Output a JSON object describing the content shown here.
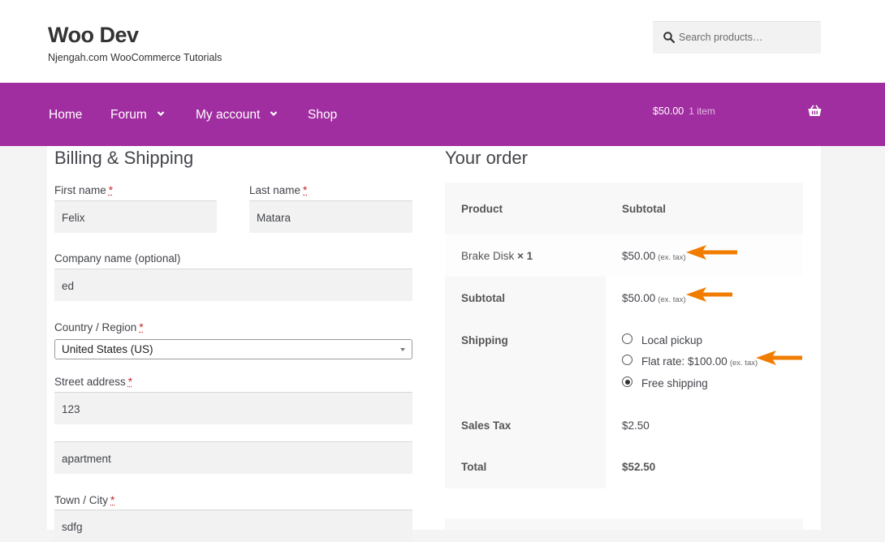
{
  "site": {
    "title": "Woo Dev",
    "description": "Njengah.com WooCommerce Tutorials"
  },
  "search": {
    "placeholder": "Search products…",
    "icon": "search-icon"
  },
  "nav": {
    "items": [
      {
        "label": "Home",
        "has_dropdown": false
      },
      {
        "label": "Forum",
        "has_dropdown": true
      },
      {
        "label": "My account",
        "has_dropdown": true
      },
      {
        "label": "Shop",
        "has_dropdown": false
      }
    ],
    "cart": {
      "amount": "$50.00",
      "count": "1 item",
      "icon": "basket-icon"
    },
    "color": "#a12ea0"
  },
  "billing": {
    "title": "Billing & Shipping",
    "required_mark": "*",
    "first_name": {
      "label": "First name",
      "value": "Felix"
    },
    "last_name": {
      "label": "Last name",
      "value": "Matara"
    },
    "company": {
      "label": "Company name (optional)",
      "value": "ed"
    },
    "country": {
      "label": "Country / Region",
      "value": "United States (US)"
    },
    "street": {
      "label": "Street address",
      "value": "123",
      "value2": "apartment"
    },
    "city": {
      "label": "Town / City",
      "value": "sdfg"
    }
  },
  "order": {
    "title": "Your order",
    "header": {
      "product": "Product",
      "subtotal": "Subtotal"
    },
    "item": {
      "name": "Brake Disk",
      "qty": "× 1",
      "price": "$50.00",
      "tax_note": "(ex. tax)"
    },
    "subtotal": {
      "label": "Subtotal",
      "value": "$50.00",
      "tax_note": "(ex. tax)"
    },
    "shipping": {
      "label": "Shipping",
      "options": [
        {
          "label": "Local pickup",
          "note": "",
          "selected": false
        },
        {
          "label": "Flat rate: $100.00",
          "note": "(ex. tax)",
          "selected": false
        },
        {
          "label": "Free shipping",
          "note": "",
          "selected": true
        }
      ]
    },
    "tax": {
      "label": "Sales Tax",
      "value": "$2.50"
    },
    "total": {
      "label": "Total",
      "value": "$52.50"
    },
    "arrow_color": "#f07c00"
  }
}
